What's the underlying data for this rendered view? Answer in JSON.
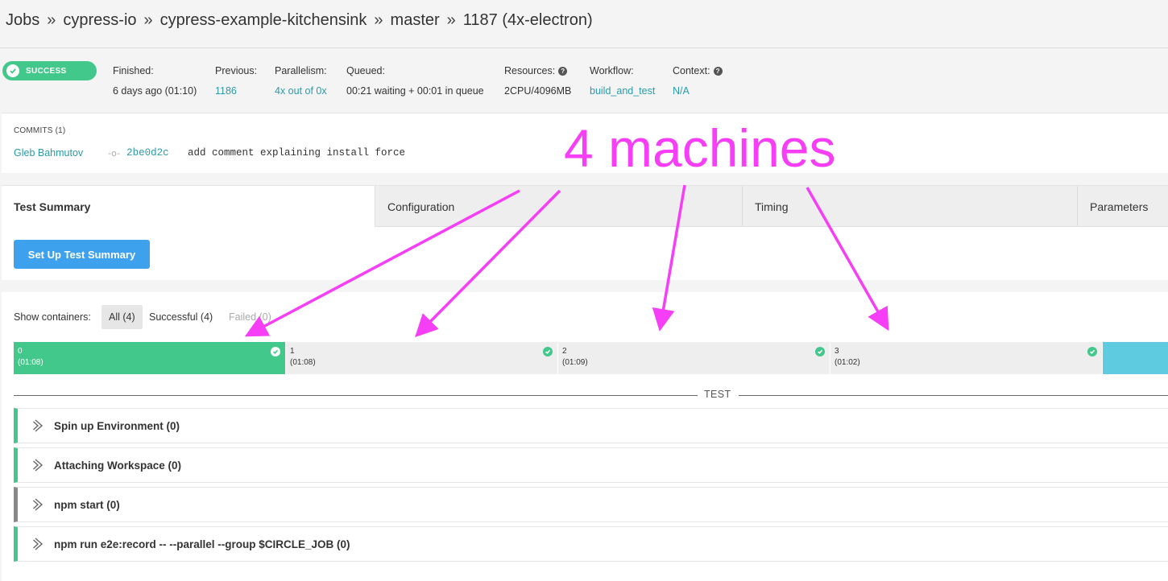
{
  "breadcrumb": {
    "items": [
      "Jobs",
      "cypress-io",
      "cypress-example-kitchensink",
      "master",
      "1187 (4x-electron)"
    ],
    "separator": "»"
  },
  "status": {
    "label": "SUCCESS",
    "color": "#42c88a"
  },
  "meta": {
    "finished": {
      "label": "Finished:",
      "value": "6 days ago (01:10)"
    },
    "previous": {
      "label": "Previous:",
      "value": "1186"
    },
    "parallelism": {
      "label": "Parallelism:",
      "value": "4x out of 0x"
    },
    "queued": {
      "label": "Queued:",
      "value": "00:21 waiting + 00:01 in queue"
    },
    "resources": {
      "label": "Resources:",
      "value": "2CPU/4096MB"
    },
    "workflow": {
      "label": "Workflow:",
      "value": "build_and_test"
    },
    "context": {
      "label": "Context:",
      "value": "N/A"
    }
  },
  "commits": {
    "header": "COMMITS (1)",
    "items": [
      {
        "author": "Gleb Bahmutov",
        "hash": "2be0d2c",
        "message": "add comment explaining install force"
      }
    ]
  },
  "tabs": [
    {
      "label": "Test Summary",
      "active": true
    },
    {
      "label": "Configuration",
      "active": false
    },
    {
      "label": "Timing",
      "active": false
    },
    {
      "label": "Parameters",
      "active": false
    }
  ],
  "setup_button": "Set Up Test Summary",
  "containers": {
    "show_label": "Show containers:",
    "filters": [
      "All (4)",
      "Successful (4)",
      "Failed (0)"
    ],
    "items": [
      {
        "index": "0",
        "duration": "(01:08)",
        "selected": true
      },
      {
        "index": "1",
        "duration": "(01:08)",
        "selected": false
      },
      {
        "index": "2",
        "duration": "(01:09)",
        "selected": false
      },
      {
        "index": "3",
        "duration": "(01:02)",
        "selected": false
      }
    ]
  },
  "section_label": "TEST",
  "steps": [
    {
      "title": "Spin up Environment (0)",
      "status_color": "#42c88a"
    },
    {
      "title": "Attaching Workspace (0)",
      "status_color": "#42c88a"
    },
    {
      "title": "npm start (0)",
      "status_color": "#888888"
    },
    {
      "title": "npm run e2e:record -- --parallel --group $CIRCLE_JOB (0)",
      "status_color": "#42c88a"
    }
  ],
  "annotation": {
    "text": "4 machines",
    "color": "#f53ef5"
  },
  "colors": {
    "accent": "#2b9aa8",
    "success": "#42c88a",
    "button": "#3ea1ee"
  }
}
